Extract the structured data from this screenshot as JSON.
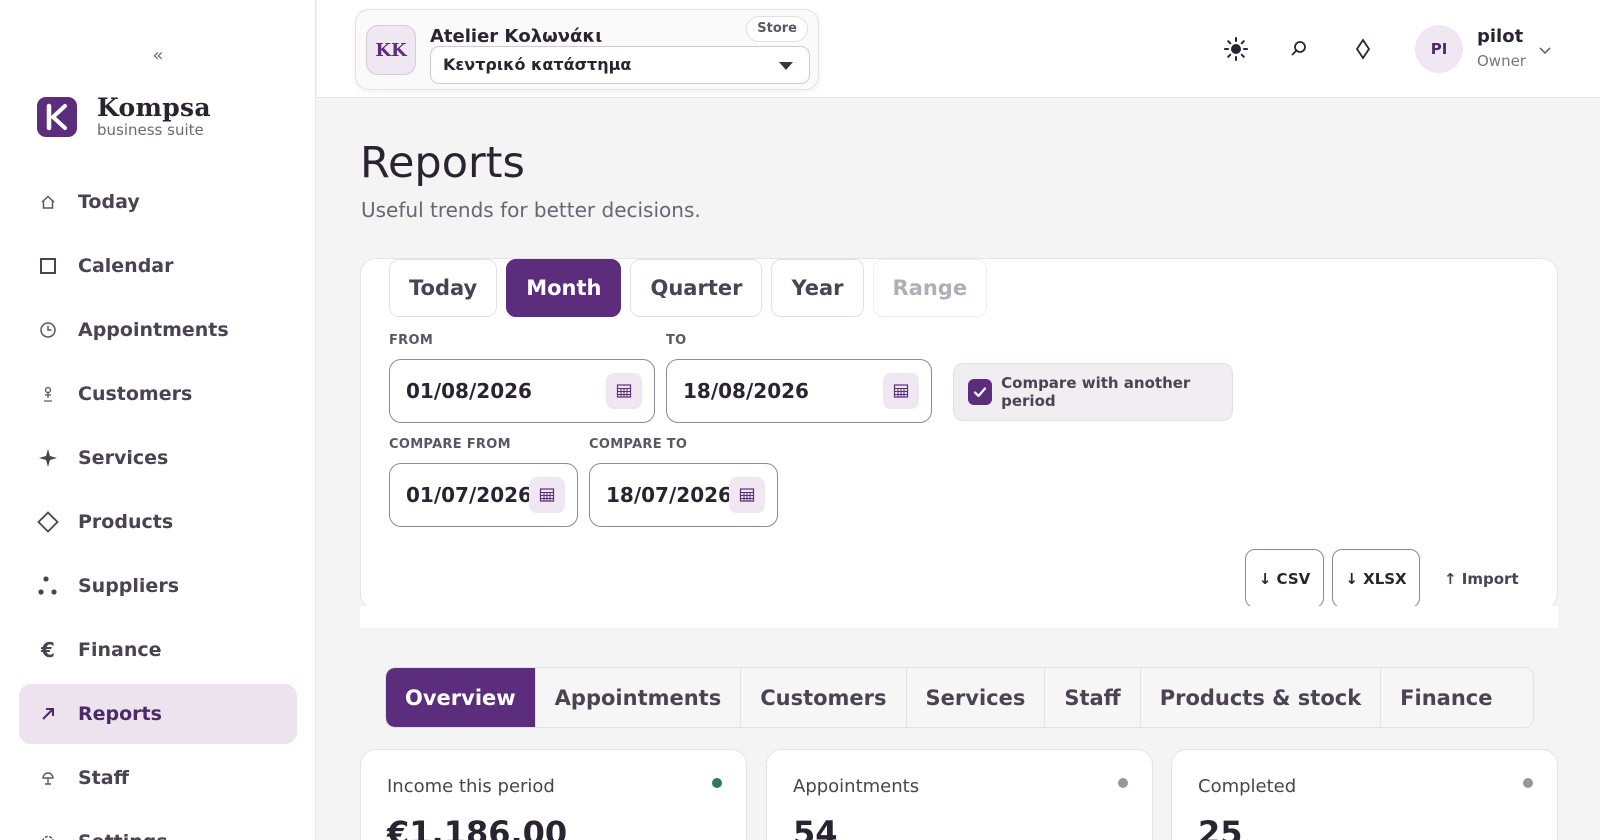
{
  "sidebar": {
    "collapse_label": "«",
    "brand_name": "Kompsa",
    "brand_sub": "business suite",
    "items": [
      {
        "label": "Today",
        "icon": "home-icon"
      },
      {
        "label": "Calendar",
        "icon": "calendar-icon"
      },
      {
        "label": "Appointments",
        "icon": "clock-icon"
      },
      {
        "label": "Customers",
        "icon": "customer-icon"
      },
      {
        "label": "Services",
        "icon": "sparkle-icon"
      },
      {
        "label": "Products",
        "icon": "diamond-icon"
      },
      {
        "label": "Suppliers",
        "icon": "network-icon"
      },
      {
        "label": "Finance",
        "icon": "euro-icon"
      },
      {
        "label": "Reports",
        "icon": "arrow-up-right-icon",
        "active": true
      },
      {
        "label": "Staff",
        "icon": "staff-icon"
      },
      {
        "label": "Settings",
        "icon": "settings-icon"
      }
    ]
  },
  "topbar": {
    "store_initials": "KK",
    "store_name": "Atelier Κολωνάκι",
    "store_tag": "Store",
    "store_selected": "Κεντρικό κατάστημα",
    "user_initials": "PI",
    "user_name": "pilot",
    "user_role": "Owner"
  },
  "page": {
    "title": "Reports",
    "subtitle": "Useful trends for better decisions."
  },
  "filters": {
    "periods": [
      {
        "label": "Today",
        "state": "normal"
      },
      {
        "label": "Month",
        "state": "active"
      },
      {
        "label": "Quarter",
        "state": "normal"
      },
      {
        "label": "Year",
        "state": "normal"
      },
      {
        "label": "Range",
        "state": "disabled"
      }
    ],
    "from_label": "FROM",
    "from_value": "01/08/2026",
    "to_label": "TO",
    "to_value": "18/08/2026",
    "compare_label": "Compare with another period",
    "compare_checked": true,
    "compare_from_label": "COMPARE FROM",
    "compare_from_value": "01/07/2026",
    "compare_to_label": "COMPARE TO",
    "compare_to_value": "18/07/2026",
    "csv_label": "↓ CSV",
    "xlsx_label": "↓ XLSX",
    "import_label": "↑ Import"
  },
  "report_tabs": [
    {
      "label": "Overview",
      "active": true
    },
    {
      "label": "Appointments"
    },
    {
      "label": "Customers"
    },
    {
      "label": "Services"
    },
    {
      "label": "Staff"
    },
    {
      "label": "Products & stock"
    },
    {
      "label": "Finance"
    }
  ],
  "stats": [
    {
      "label": "Income this period",
      "value": "€1,186.00",
      "dot_color": "#2f7a5a"
    },
    {
      "label": "Appointments",
      "value": "54",
      "dot_color": "#9a959e"
    },
    {
      "label": "Completed",
      "value": "25",
      "dot_color": "#9a959e"
    }
  ],
  "colors": {
    "accent": "#5b2d7c",
    "accent_soft": "#ece3ef",
    "success": "#2f7a5a"
  }
}
